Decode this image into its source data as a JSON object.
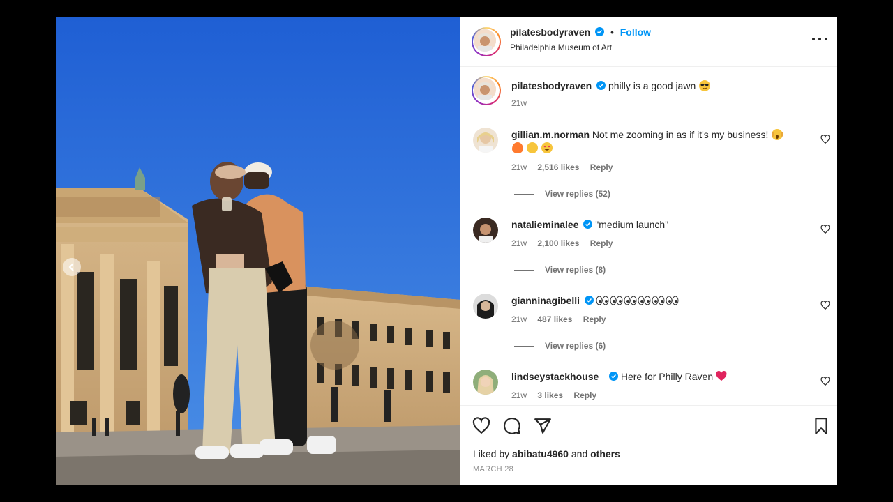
{
  "header": {
    "username": "pilatesbodyraven",
    "separator": "•",
    "follow_label": "Follow",
    "location": "Philadelphia Museum of Art"
  },
  "caption": {
    "username": "pilatesbodyraven",
    "text": "philly is a good jawn",
    "emoji": "😎",
    "time": "21w"
  },
  "comments": [
    {
      "username": "gillian.m.norman",
      "text": "Not me zooming in as if it's my business!",
      "emoji": [
        "😱",
        "🔥",
        "👏",
        "😍"
      ],
      "time": "21w",
      "likes": "2,516 likes",
      "reply_label": "Reply",
      "view_replies": "View replies (52)",
      "verified": false
    },
    {
      "username": "natalieminalee",
      "text": "\"medium launch\"",
      "emoji": [],
      "time": "21w",
      "likes": "2,100 likes",
      "reply_label": "Reply",
      "view_replies": "View replies (8)",
      "verified": true
    },
    {
      "username": "gianninagibelli",
      "text": "",
      "emoji": [
        "👀",
        "👀",
        "👀",
        "👀",
        "👀",
        "👀"
      ],
      "time": "21w",
      "likes": "487 likes",
      "reply_label": "Reply",
      "view_replies": "View replies (6)",
      "verified": true
    },
    {
      "username": "lindseystackhouse_",
      "text": "Here for Philly Raven",
      "emoji": [
        "❤️"
      ],
      "time": "21w",
      "likes": "3 likes",
      "reply_label": "Reply",
      "view_replies": "",
      "verified": true
    }
  ],
  "footer": {
    "liked_prefix": "Liked by",
    "liked_user": "abibatu4960",
    "liked_and": "and",
    "liked_others": "others",
    "date": "MARCH 28"
  },
  "icons": {
    "like": "heart-icon",
    "comment": "comment-icon",
    "share": "share-icon",
    "save": "bookmark-icon",
    "more": "more-options-icon",
    "verified": "verified-badge-icon",
    "prev": "chevron-left-icon"
  },
  "colors": {
    "follow": "#0095f6",
    "verified": "#0095f6",
    "muted": "#737373",
    "text": "#262626",
    "sky": "#2f6fd9",
    "heart_emoji": "#e0245e"
  }
}
